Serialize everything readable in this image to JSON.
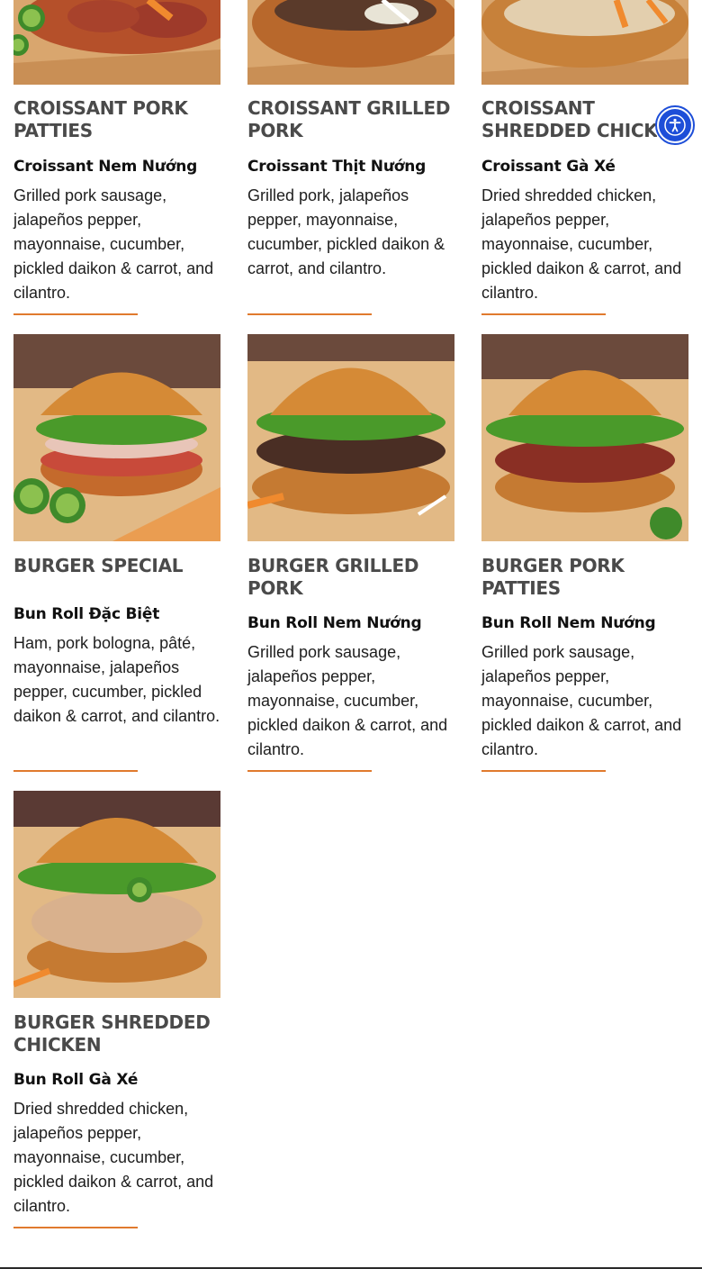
{
  "items": [
    {
      "title": "CROISSANT PORK\nPATTIES",
      "subtitle": "Croissant Nem Nướng",
      "description": "Grilled pork sausage, jalapeños pepper, mayonnaise, cucumber, pickled daikon & carrot, and cilantro."
    },
    {
      "title": "CROISSANT GRILLED\nPORK",
      "subtitle": "Croissant Thịt Nướng",
      "description": "Grilled pork, jalapeños pepper, mayonnaise, cucumber, pickled daikon & carrot, and cilantro."
    },
    {
      "title": "CROISSANT\nSHREDDED CHICKEN",
      "subtitle": "Croissant Gà Xé",
      "description": "Dried shredded chicken, jalapeños pepper, mayonnaise, cucumber, pickled daikon & carrot, and cilantro."
    },
    {
      "title": "BURGER SPECIAL",
      "subtitle": "Bun Roll Đặc Biệt",
      "description": "Ham, pork bologna, pâté, mayonnaise, jalapeños pepper, cucumber, pickled daikon & carrot, and cilantro."
    },
    {
      "title": "BURGER GRILLED\nPORK",
      "subtitle": "Bun Roll Nem Nướng",
      "description": "Grilled pork sausage, jalapeños pepper, mayonnaise, cucumber, pickled daikon & carrot, and cilantro."
    },
    {
      "title": "BURGER PORK\nPATTIES",
      "subtitle": "Bun Roll Nem Nướng",
      "description": "Grilled pork sausage, jalapeños pepper, mayonnaise, cucumber, pickled daikon & carrot, and cilantro."
    },
    {
      "title": "BURGER SHREDDED\nCHICKEN",
      "subtitle": "Bun Roll Gà Xé",
      "description": "Dried shredded chicken, jalapeños pepper, mayonnaise, cucumber, pickled daikon & carrot, and cilantro."
    }
  ],
  "accessibility": {
    "icon": "accessibility-icon"
  },
  "colors": {
    "accent": "#e07a2e",
    "title": "#4a4a4a",
    "a11y": "#1d4ed8"
  }
}
